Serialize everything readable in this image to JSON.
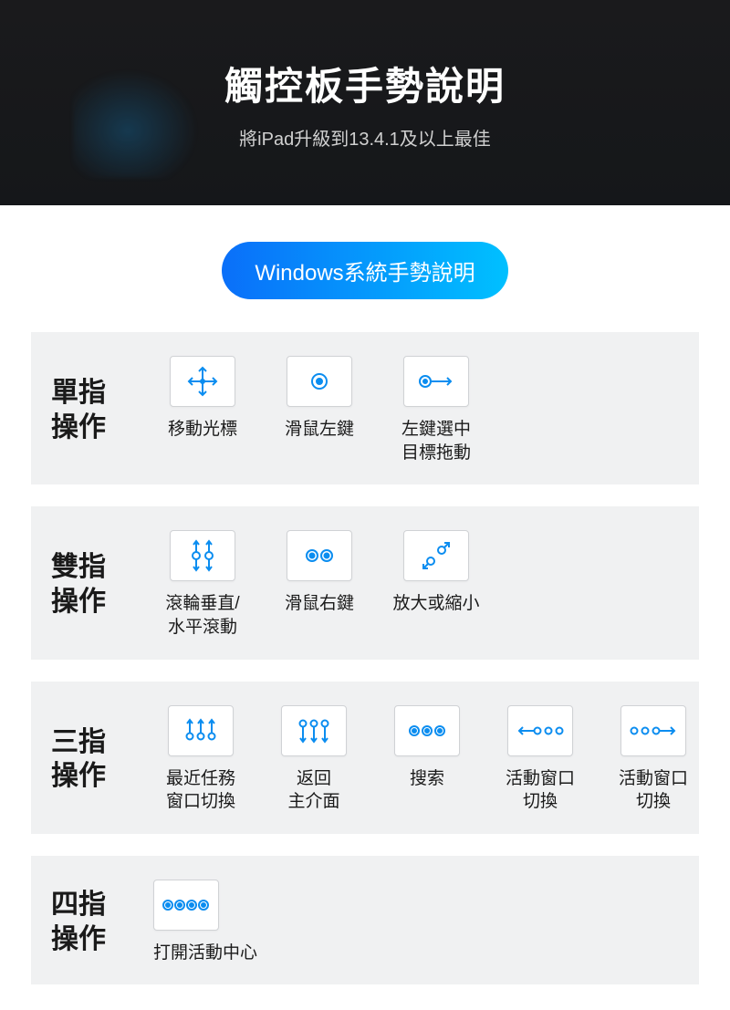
{
  "header": {
    "title": "觸控板手勢說明",
    "subtitle": "將iPad升級到13.4.1及以上最佳"
  },
  "badge": "Windows系統手勢說明",
  "sections": {
    "one": {
      "title": "單指\n操作",
      "gestures": [
        {
          "label": "移動光標"
        },
        {
          "label": "滑鼠左鍵"
        },
        {
          "label": "左鍵選中\n目標拖動"
        }
      ]
    },
    "two": {
      "title": "雙指\n操作",
      "gestures": [
        {
          "label": "滾輪垂直/\n水平滾動"
        },
        {
          "label": "滑鼠右鍵"
        },
        {
          "label": "放大或縮小"
        }
      ]
    },
    "three": {
      "title": "三指\n操作",
      "gestures": [
        {
          "label": "最近任務\n窗口切換"
        },
        {
          "label": "返回\n主介面"
        },
        {
          "label": "搜索"
        },
        {
          "label": "活動窗口\n切換"
        },
        {
          "label": "活動窗口\n切換"
        }
      ]
    },
    "four": {
      "title": "四指\n操作",
      "gestures": [
        {
          "label": "打開活動中心"
        }
      ]
    }
  }
}
